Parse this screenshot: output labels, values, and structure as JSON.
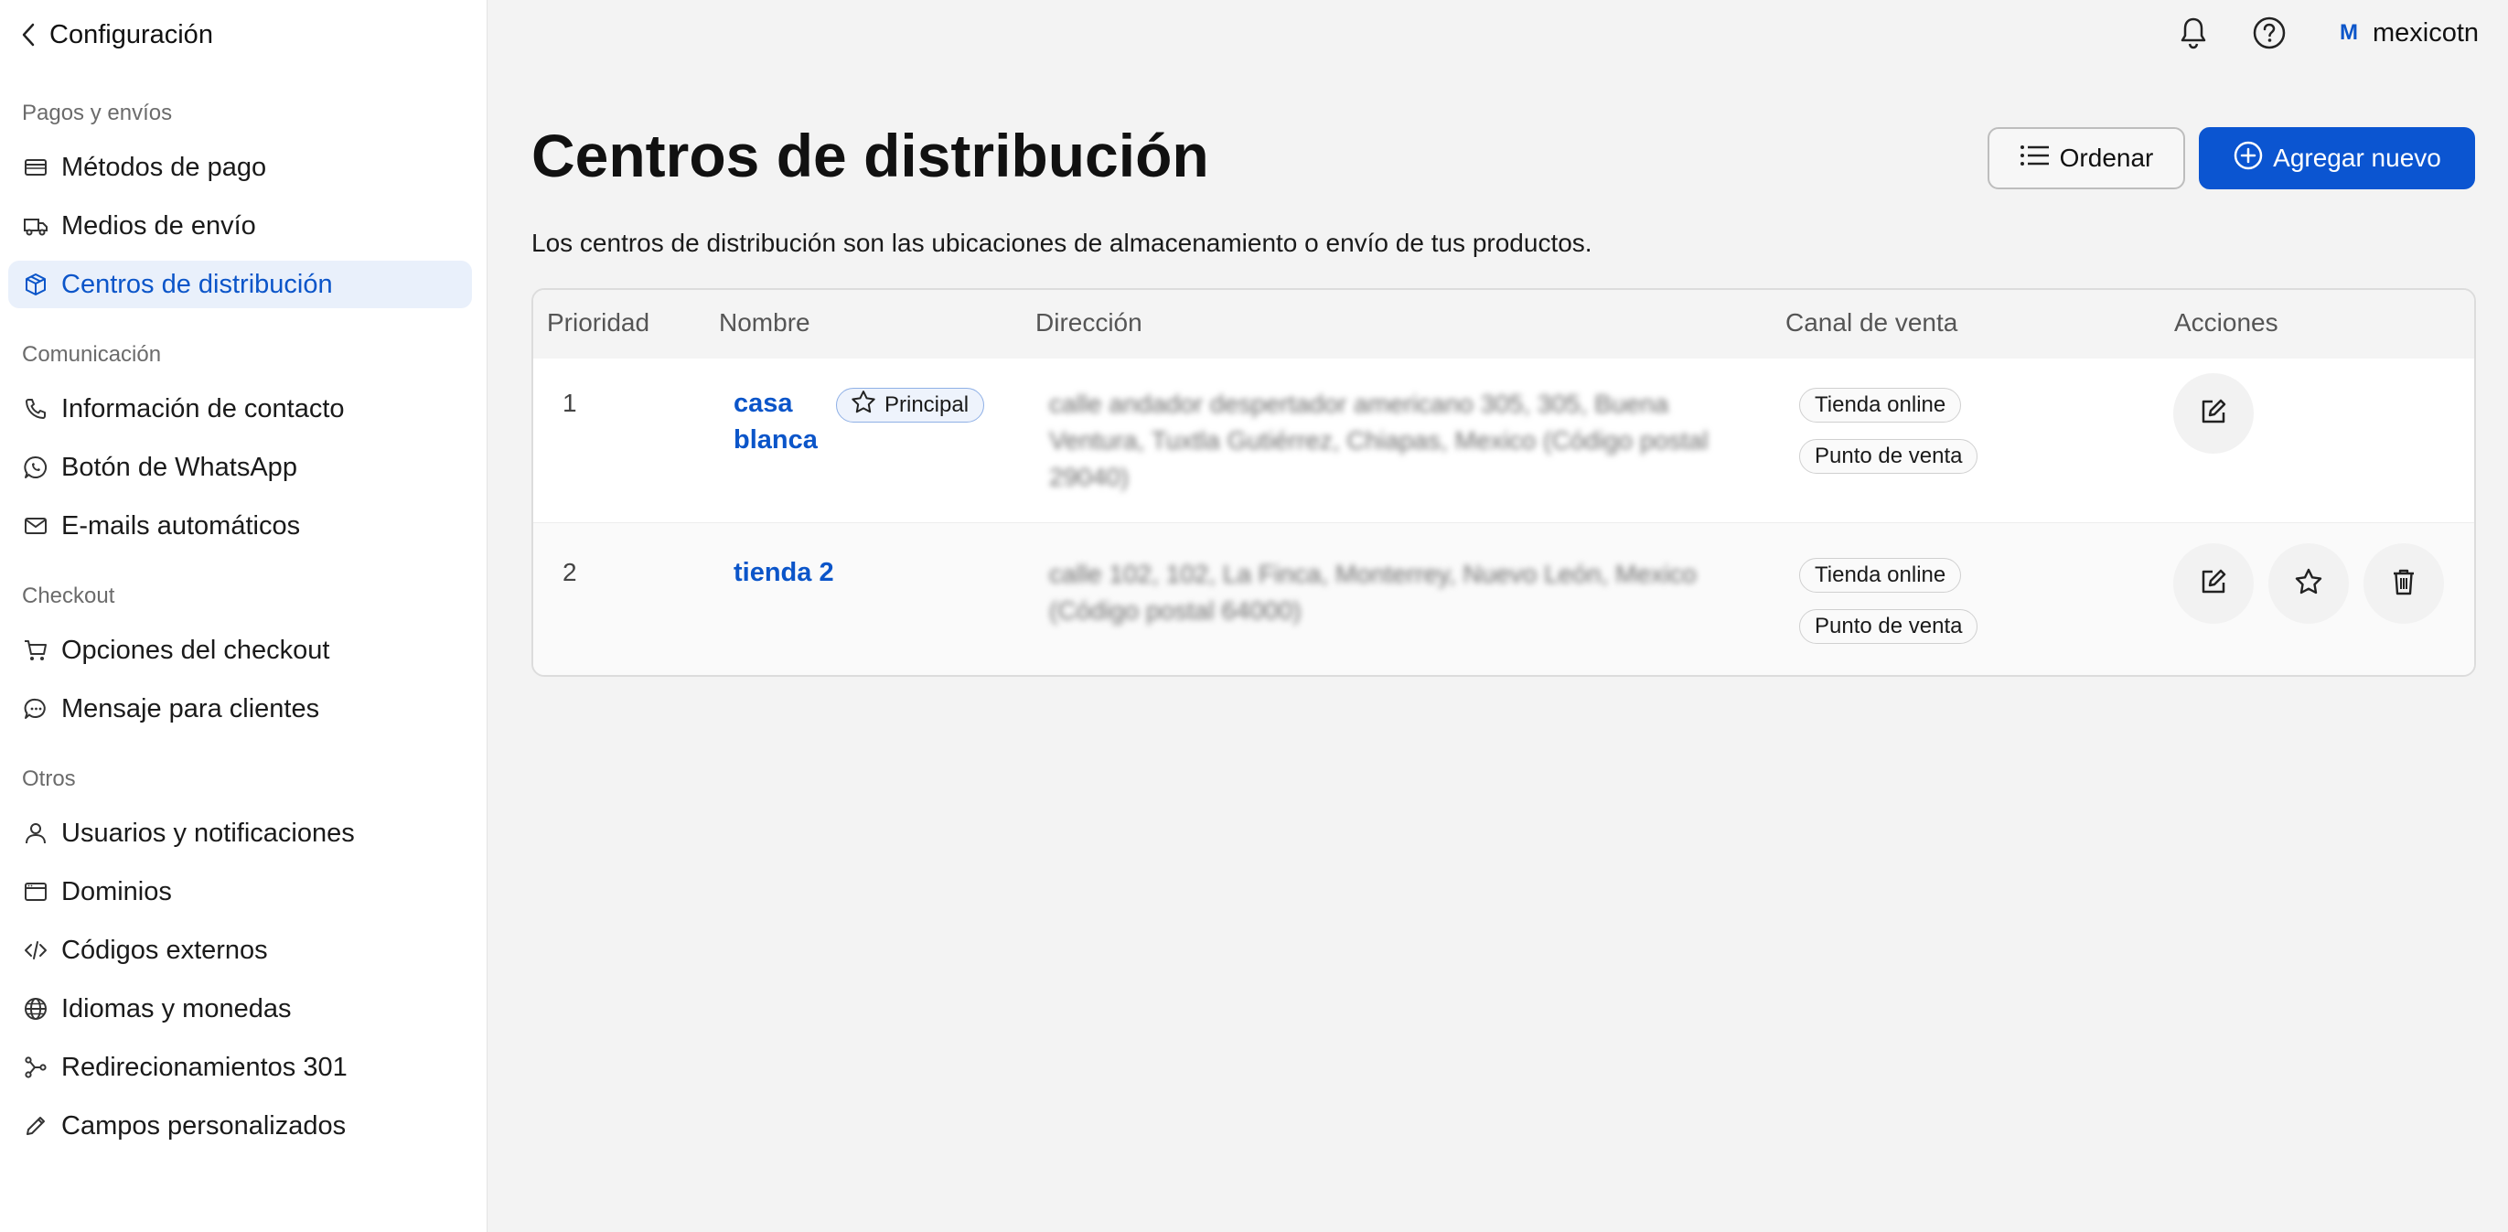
{
  "sidebar": {
    "back_label": "Configuración",
    "sections": [
      {
        "label": "Pagos y envíos"
      },
      {
        "label": "Comunicación"
      },
      {
        "label": "Checkout"
      },
      {
        "label": "Otros"
      }
    ],
    "items": [
      {
        "label": "Métodos de pago",
        "icon": "credit-card-icon"
      },
      {
        "label": "Medios de envío",
        "icon": "truck-icon"
      },
      {
        "label": "Centros de distribución",
        "icon": "box-icon",
        "active": true
      },
      {
        "label": "Información de contacto",
        "icon": "phone-icon"
      },
      {
        "label": "Botón de WhatsApp",
        "icon": "whatsapp-icon"
      },
      {
        "label": "E-mails automáticos",
        "icon": "mail-icon"
      },
      {
        "label": "Opciones del checkout",
        "icon": "cart-icon"
      },
      {
        "label": "Mensaje para clientes",
        "icon": "chat-icon"
      },
      {
        "label": "Usuarios y notificaciones",
        "icon": "user-icon"
      },
      {
        "label": "Dominios",
        "icon": "browser-icon"
      },
      {
        "label": "Códigos externos",
        "icon": "code-icon"
      },
      {
        "label": "Idiomas y monedas",
        "icon": "globe-icon"
      },
      {
        "label": "Redirecionamientos 301",
        "icon": "share-icon"
      },
      {
        "label": "Campos personalizados",
        "icon": "pencil-icon"
      }
    ]
  },
  "topbar": {
    "user_initial": "M",
    "user_name": "mexicotn"
  },
  "page": {
    "title": "Centros de distribución",
    "subtitle": "Los centros de distribución son las ubicaciones de almacenamiento o envío de tus productos.",
    "order_button": "Ordenar",
    "add_button": "Agregar nuevo"
  },
  "table": {
    "headers": [
      "Prioridad",
      "Nombre",
      "Dirección",
      "Canal de venta",
      "Acciones"
    ],
    "rows": [
      {
        "priority": "1",
        "name_line1": "casa",
        "name_line2": "blanca",
        "badge": "Principal",
        "address_l1": "calle andador despertador americano 305, 305, Buena",
        "address_l2": "Ventura, Tuxtla Gutiérrez, Chiapas, Mexico (Código postal",
        "address_l3": "29040)",
        "channels": [
          "Tienda online",
          "Punto de venta"
        ]
      },
      {
        "priority": "2",
        "name_line1": "tienda 2",
        "address_l1": "calle 102, 102, La Finca, Monterrey, Nuevo León, Mexico",
        "address_l2": "(Código postal 64000)",
        "channels": [
          "Tienda online",
          "Punto de venta"
        ]
      }
    ]
  },
  "colors": {
    "accent": "#0b55c9",
    "primary_button": "#0b55d1",
    "active_nav_bg": "#e9f0fb"
  }
}
